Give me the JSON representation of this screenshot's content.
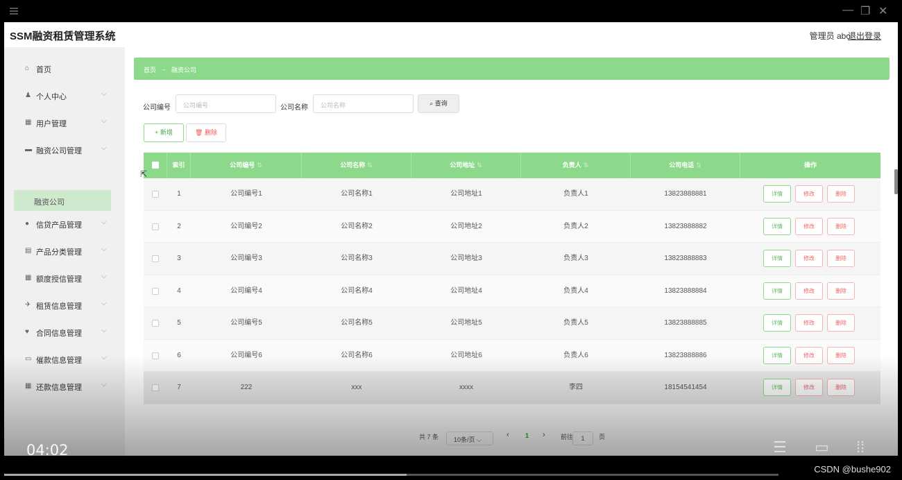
{
  "window": {
    "minimize": "—",
    "restore": "❐",
    "close": "✕"
  },
  "header": {
    "title": "SSM融资租赁管理系统",
    "user": "管理员 abo",
    "logout": "退出登录"
  },
  "sidebar": {
    "items": [
      {
        "icon": "⌂",
        "label": "首页",
        "chevron": ""
      },
      {
        "icon": "♟",
        "label": "个人中心",
        "chevron": "⌵"
      },
      {
        "icon": "▦",
        "label": "用户管理",
        "chevron": "⌵"
      },
      {
        "icon": "▬",
        "label": "融资公司管理",
        "chevron": "⌵"
      },
      {
        "icon": "●",
        "label": "信贷产品管理",
        "chevron": "⌵"
      },
      {
        "icon": "▤",
        "label": "产品分类管理",
        "chevron": "⌵"
      },
      {
        "icon": "▦",
        "label": "额度授信管理",
        "chevron": "⌵"
      },
      {
        "icon": "✈",
        "label": "租赁信息管理",
        "chevron": "⌵"
      },
      {
        "icon": "♥",
        "label": "合同信息管理",
        "chevron": "⌵"
      },
      {
        "icon": "▭",
        "label": "催款信息管理",
        "chevron": "⌵"
      },
      {
        "icon": "▦",
        "label": "还款信息管理",
        "chevron": "⌵"
      }
    ],
    "sub_active": "融资公司"
  },
  "breadcrumb": {
    "home": "首页",
    "arrow": "→",
    "current": "融资公司"
  },
  "search": {
    "code_label": "公司编号",
    "code_placeholder": "公司编号",
    "name_label": "公司名称",
    "name_placeholder": "公司名称",
    "button": "⌕ 查询"
  },
  "actions": {
    "add": "+ 新增",
    "delete": "🗑 删除"
  },
  "table": {
    "headers": [
      "索引",
      "公司编号",
      "公司名称",
      "公司地址",
      "负责人",
      "公司电话",
      "操作"
    ],
    "sort_mark": "⇅",
    "rows": [
      {
        "index": "1",
        "code": "公司编号1",
        "name": "公司名称1",
        "address": "公司地址1",
        "person": "负责人1",
        "phone": "13823888881"
      },
      {
        "index": "2",
        "code": "公司编号2",
        "name": "公司名称2",
        "address": "公司地址2",
        "person": "负责人2",
        "phone": "13823888882"
      },
      {
        "index": "3",
        "code": "公司编号3",
        "name": "公司名称3",
        "address": "公司地址3",
        "person": "负责人3",
        "phone": "13823888883"
      },
      {
        "index": "4",
        "code": "公司编号4",
        "name": "公司名称4",
        "address": "公司地址4",
        "person": "负责人4",
        "phone": "13823888884"
      },
      {
        "index": "5",
        "code": "公司编号5",
        "name": "公司名称5",
        "address": "公司地址5",
        "person": "负责人5",
        "phone": "13823888885"
      },
      {
        "index": "6",
        "code": "公司编号6",
        "name": "公司名称6",
        "address": "公司地址6",
        "person": "负责人6",
        "phone": "13823888886"
      },
      {
        "index": "7",
        "code": "222",
        "name": "xxx",
        "address": "xxxx",
        "person": "李四",
        "phone": "18154541454"
      }
    ],
    "row_buttons": {
      "detail": "详情",
      "edit": "修改",
      "delete": "删除"
    }
  },
  "pagination": {
    "total": "共 7 条",
    "page_size": "10条/页 ⌵",
    "prev": "‹",
    "current": "1",
    "next": "›",
    "goto_label": "前往",
    "goto_value": "1",
    "page_suffix": "页"
  },
  "video": {
    "time": "04:02",
    "progress": 0.52
  },
  "watermark": "CSDN @bushe902",
  "colors": {
    "accent": "#8cd98c",
    "danger": "#ee6666"
  }
}
